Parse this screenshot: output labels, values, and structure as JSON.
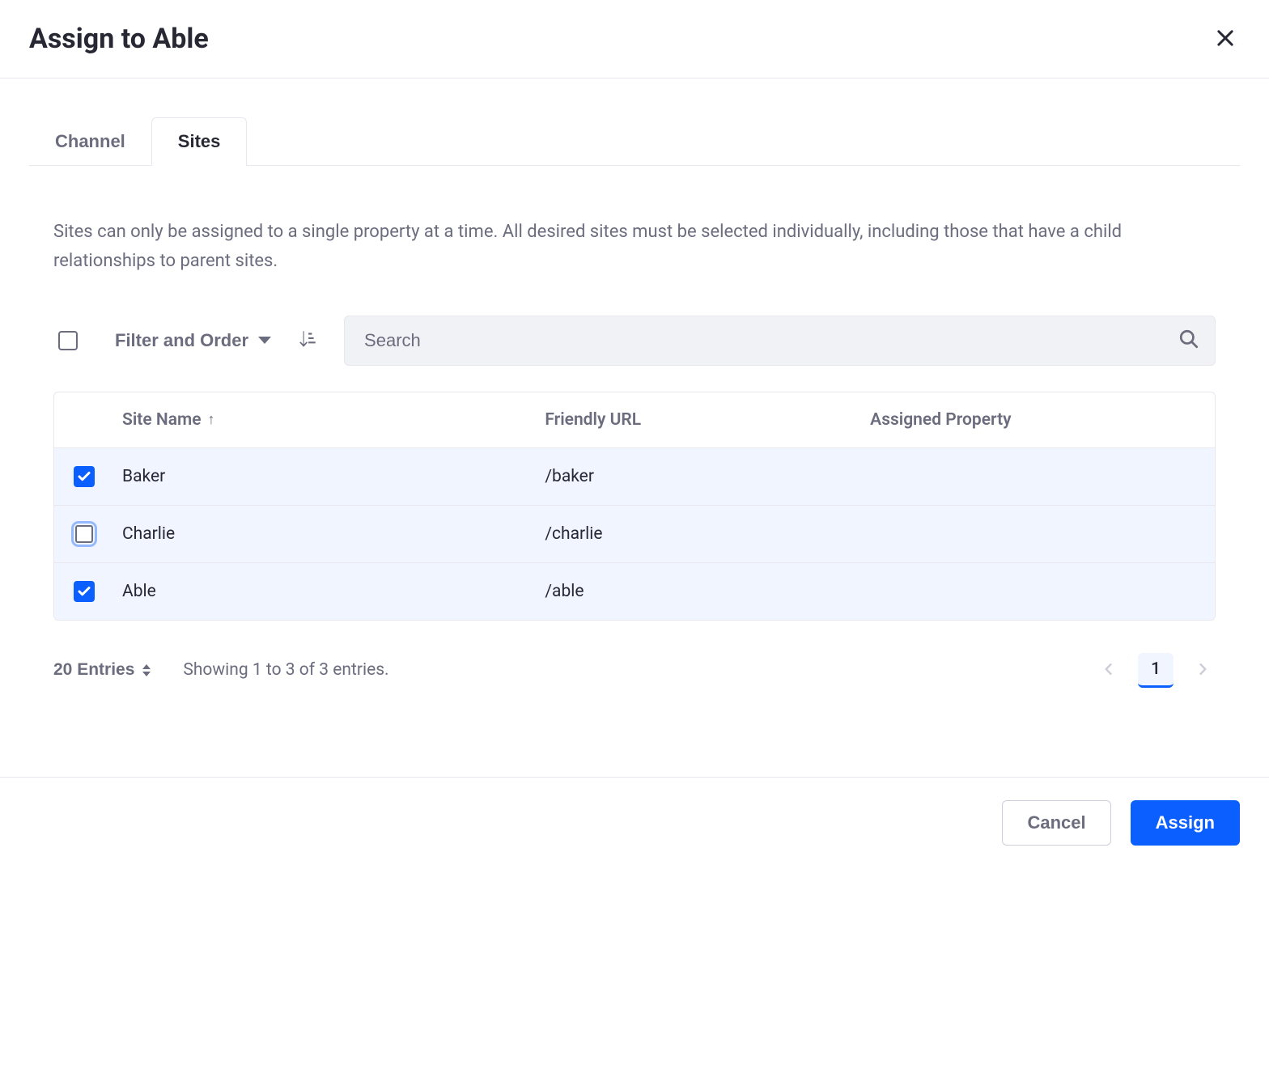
{
  "header": {
    "title": "Assign to Able"
  },
  "tabs": [
    {
      "label": "Channel",
      "active": false
    },
    {
      "label": "Sites",
      "active": true
    }
  ],
  "description": "Sites can only be assigned to a single property at a time. All desired sites must be selected individually, including those that have a child relationships to parent sites.",
  "toolbar": {
    "filter_label": "Filter and Order",
    "search_placeholder": "Search"
  },
  "table": {
    "columns": {
      "site_name": "Site Name",
      "sort_indicator": "↑",
      "friendly_url": "Friendly URL",
      "assigned_property": "Assigned Property"
    },
    "rows": [
      {
        "checked": true,
        "focused": false,
        "name": "Baker",
        "url": "/baker",
        "property": ""
      },
      {
        "checked": false,
        "focused": true,
        "name": "Charlie",
        "url": "/charlie",
        "property": ""
      },
      {
        "checked": true,
        "focused": false,
        "name": "Able",
        "url": "/able",
        "property": ""
      }
    ]
  },
  "pagination": {
    "entries_label": "20 Entries",
    "showing": "Showing 1 to 3 of 3 entries.",
    "current_page": "1"
  },
  "footer": {
    "cancel_label": "Cancel",
    "assign_label": "Assign"
  }
}
